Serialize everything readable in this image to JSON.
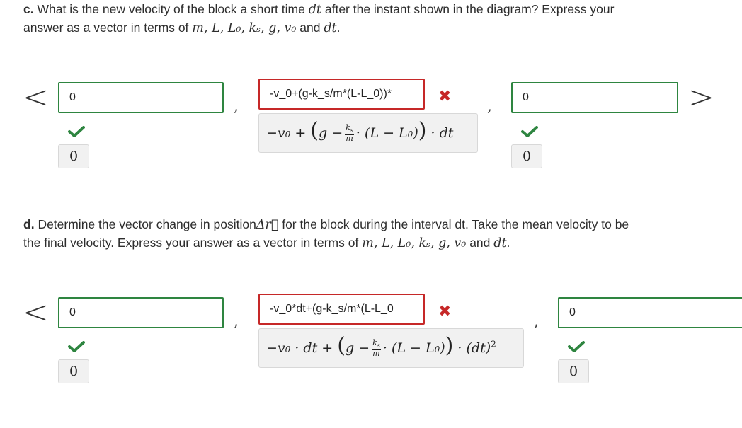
{
  "part_c": {
    "label": "c.",
    "text": "What is the new velocity of the block a short time",
    "text2": "after the instant shown in the diagram? Express your",
    "text3": "answer as a vector in terms of",
    "vars": "m, L, L₀, kₛ, g, v₀",
    "and": "and",
    "dt": "dt",
    "period": ".",
    "left_bracket": "<",
    "right_bracket": ">",
    "x_input": "0",
    "x_preview": "0",
    "y_input": "-v_0+(g-k_s/m*(L-L_0))*",
    "z_input": "0",
    "z_preview": "0"
  },
  "part_d": {
    "label": "d.",
    "text": "Determine the vector change in position",
    "delta_r": "Δr⃗",
    "text2": "for the block during the interval dt. Take the mean velocity to be",
    "text3": "the final velocity. Express your answer as a vector in terms of",
    "vars": "m, L, L₀, kₛ, g, v₀",
    "and": "and",
    "dt": "dt",
    "period": ".",
    "left_bracket": "<",
    "x_input": "0",
    "x_preview": "0",
    "y_input": "-v_0*dt+(g-k_s/m*(L-L_0",
    "z_input": "0",
    "z_preview": "0"
  },
  "symbols": {
    "comma": ",",
    "cross": "✖"
  },
  "colors": {
    "correct": "#2e8540",
    "incorrect": "#c62828",
    "preview_bg": "#f1f1f1"
  }
}
